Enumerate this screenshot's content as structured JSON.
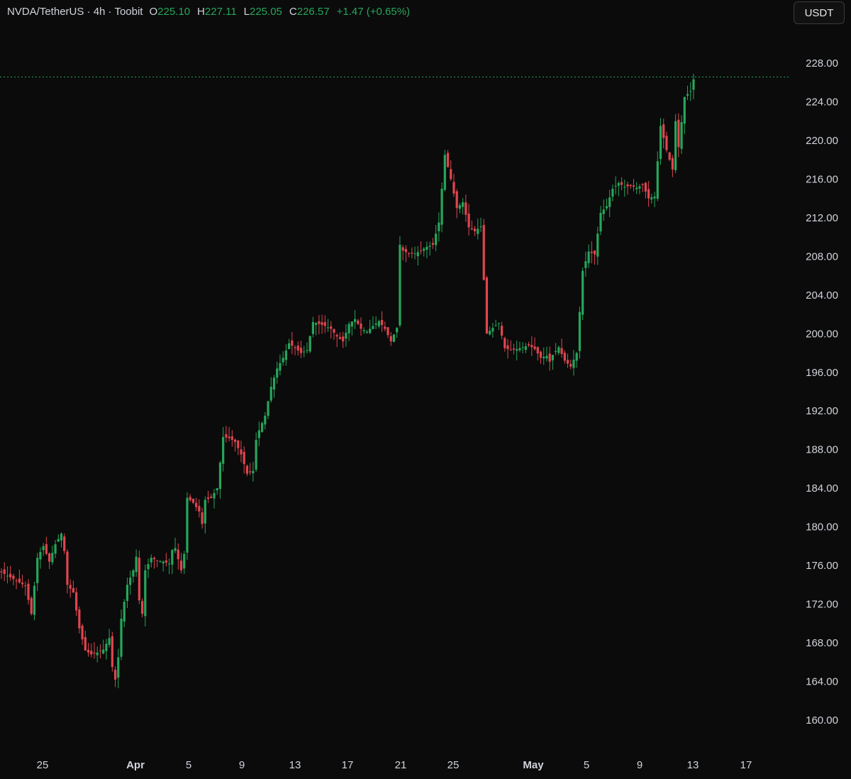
{
  "legend": {
    "symbol": "NVDA/TetherUS · 4h · Toobit",
    "open_label": "O",
    "open": "225.10",
    "high_label": "H",
    "high": "227.11",
    "low_label": "L",
    "low": "225.05",
    "close_label": "C",
    "close": "226.57",
    "change": "+1.47 (+0.65%)"
  },
  "currency_button": "USDT",
  "colors": {
    "up": "#26a65b",
    "down": "#e0454f",
    "background": "#0b0b0b",
    "axis_text": "#d1d4dc",
    "last_price_line": "#26a65b"
  },
  "chart_data": {
    "type": "candlestick",
    "title": "",
    "interval": "4h",
    "yaxis_ticks": [
      "228.00",
      "224.00",
      "220.00",
      "216.00",
      "212.00",
      "208.00",
      "204.00",
      "200.00",
      "196.00",
      "192.00",
      "188.00",
      "184.00",
      "180.00",
      "176.00",
      "172.00",
      "168.00",
      "164.00",
      "160.00"
    ],
    "xaxis_ticks": [
      "25",
      "Apr",
      "5",
      "9",
      "13",
      "17",
      "21",
      "25",
      "May",
      "5",
      "9",
      "13",
      "17"
    ],
    "ylim": [
      157.5,
      230.5
    ],
    "last_price": 226.57,
    "grid": false,
    "close_path": [
      [
        0,
        175.3
      ],
      [
        2,
        174.6
      ],
      [
        4,
        173.9
      ],
      [
        5,
        171.0
      ],
      [
        6,
        176.8
      ],
      [
        7,
        178.0
      ],
      [
        8,
        176.4
      ],
      [
        9,
        178.2
      ],
      [
        10,
        179.3
      ],
      [
        10.5,
        177.5
      ],
      [
        11,
        174.0
      ],
      [
        12,
        173.2
      ],
      [
        13,
        169.5
      ],
      [
        14,
        167.2
      ],
      [
        15,
        166.8
      ],
      [
        16,
        167.0
      ],
      [
        17,
        167.3
      ],
      [
        18,
        168.5
      ],
      [
        18.5,
        165.5
      ],
      [
        19,
        164.2
      ],
      [
        19.5,
        166.5
      ],
      [
        20,
        170.5
      ],
      [
        21,
        174.0
      ],
      [
        22,
        175.5
      ],
      [
        22.6,
        177.2
      ],
      [
        23,
        172.4
      ],
      [
        23.5,
        171.0
      ],
      [
        24,
        175.5
      ],
      [
        25,
        176.8
      ],
      [
        26,
        176.5
      ],
      [
        27,
        176.4
      ],
      [
        28,
        176.2
      ],
      [
        28.5,
        177.6
      ],
      [
        29,
        177.8
      ],
      [
        30,
        175.5
      ],
      [
        30.5,
        177.2
      ],
      [
        31,
        183.0
      ],
      [
        32,
        182.5
      ],
      [
        33,
        181.6
      ],
      [
        33.5,
        180.3
      ],
      [
        34,
        182.8
      ],
      [
        35,
        183.0
      ],
      [
        36,
        184.0
      ],
      [
        37,
        189.3
      ],
      [
        38,
        189.2
      ],
      [
        39,
        188.8
      ],
      [
        40,
        187.5
      ],
      [
        41,
        185.5
      ],
      [
        42,
        185.8
      ],
      [
        42.5,
        189.0
      ],
      [
        43,
        190.0
      ],
      [
        44,
        191.5
      ],
      [
        45,
        194.5
      ],
      [
        46,
        196.4
      ],
      [
        47,
        197.5
      ],
      [
        48,
        199.0
      ],
      [
        49,
        198.5
      ],
      [
        50,
        198.0
      ],
      [
        51,
        198.3
      ],
      [
        52,
        201.2
      ],
      [
        53,
        201.0
      ],
      [
        54,
        200.8
      ],
      [
        55,
        200.5
      ],
      [
        56,
        199.7
      ],
      [
        57,
        199.2
      ],
      [
        58,
        201.0
      ],
      [
        59,
        201.5
      ],
      [
        60,
        200.5
      ],
      [
        61,
        200.2
      ],
      [
        62,
        200.8
      ],
      [
        63,
        201.3
      ],
      [
        64,
        200.5
      ],
      [
        65,
        199.2
      ],
      [
        66,
        200.6
      ],
      [
        66.5,
        209.2
      ],
      [
        67,
        208.6
      ],
      [
        68,
        208.3
      ],
      [
        69,
        208.3
      ],
      [
        70,
        208.6
      ],
      [
        71,
        209.0
      ],
      [
        72,
        209.2
      ],
      [
        73,
        211.5
      ],
      [
        74,
        218.5
      ],
      [
        75,
        216.0
      ],
      [
        76,
        213.0
      ],
      [
        77,
        213.6
      ],
      [
        78,
        211.0
      ],
      [
        79,
        210.6
      ],
      [
        80,
        211.1
      ],
      [
        81,
        200.0
      ],
      [
        82,
        200.6
      ],
      [
        83,
        201.1
      ],
      [
        84,
        198.5
      ],
      [
        85,
        198.3
      ],
      [
        86,
        198.4
      ],
      [
        87,
        198.6
      ],
      [
        88,
        198.8
      ],
      [
        89,
        198.4
      ],
      [
        90,
        197.5
      ],
      [
        91,
        197.7
      ],
      [
        91.5,
        197.1
      ],
      [
        92,
        197.8
      ],
      [
        93,
        198.6
      ],
      [
        94,
        197.2
      ],
      [
        95,
        196.6
      ],
      [
        96,
        198.0
      ],
      [
        97,
        206.5
      ],
      [
        98,
        208.5
      ],
      [
        99,
        208.2
      ],
      [
        100,
        212.5
      ],
      [
        101,
        213.2
      ],
      [
        102,
        215.0
      ],
      [
        103,
        215.6
      ],
      [
        104,
        215.2
      ],
      [
        105,
        215.3
      ],
      [
        106,
        215.1
      ],
      [
        107,
        215.4
      ],
      [
        108,
        214.0
      ],
      [
        109,
        214.2
      ],
      [
        110,
        221.5
      ],
      [
        111,
        219.0
      ],
      [
        112,
        217.0
      ],
      [
        112.5,
        222.0
      ],
      [
        113,
        219.3
      ],
      [
        114,
        224.5
      ],
      [
        115,
        225.1
      ],
      [
        115.6,
        226.57
      ]
    ]
  }
}
